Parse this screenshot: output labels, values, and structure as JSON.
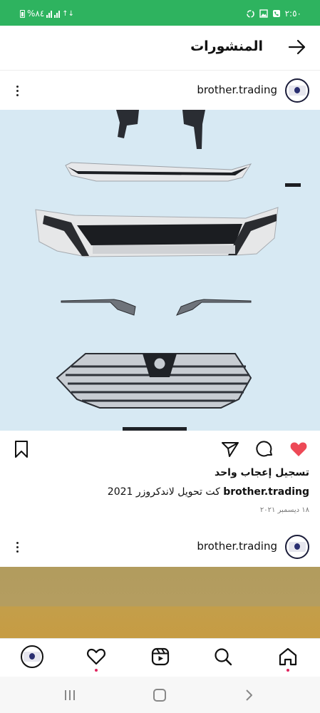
{
  "status_bar": {
    "time": "٢:٥٠",
    "battery": "%٨٤",
    "data_label": "↑↓"
  },
  "header": {
    "title": "المنشورات",
    "back_icon": "arrow-right-icon"
  },
  "posts": [
    {
      "username": "brother.trading",
      "likes_text": "تسجيل إعجاب واحد",
      "caption_user": "brother.trading",
      "caption_text": " كت تحويل لاندكروزر 2021",
      "date": "١٨ ديسمبر ٢٠٢١",
      "liked": true
    },
    {
      "username": "brother.trading"
    }
  ],
  "bottom_nav": {
    "items": [
      "home-icon",
      "search-icon",
      "reels-icon",
      "heart-icon",
      "profile-avatar"
    ]
  },
  "colors": {
    "status_bar": "#2eb35f",
    "like_red": "#ed4956",
    "notification_dot": "#e0245e"
  }
}
